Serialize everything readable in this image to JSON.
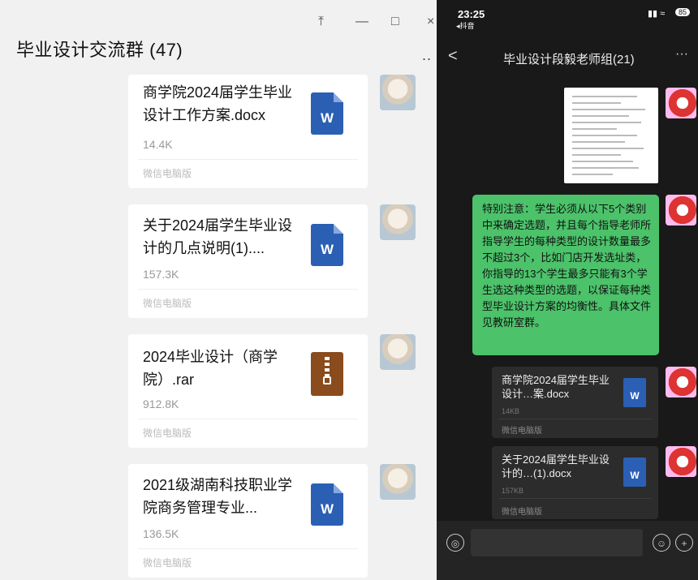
{
  "left": {
    "title": "毕业设计交流群 (47)",
    "window_buttons": {
      "pin": "⤒",
      "min": "—",
      "max": "□",
      "close": "×"
    },
    "more": "..",
    "files": [
      {
        "name": "商学院2024届学生毕业设计工作方案.docx",
        "size": "14.4K",
        "source": "微信电脑版",
        "type": "docx",
        "icon": "W"
      },
      {
        "name": "关于2024届学生毕业设计的几点说明(1)....",
        "size": "157.3K",
        "source": "微信电脑版",
        "type": "docx",
        "icon": "W"
      },
      {
        "name": "2024毕业设计（商学院）.rar",
        "size": "912.8K",
        "source": "微信电脑版",
        "type": "rar",
        "icon": ""
      },
      {
        "name": "2021级湖南科技职业学院商务管理专业...",
        "size": "136.5K",
        "source": "微信电脑版",
        "type": "docx",
        "icon": "W"
      }
    ]
  },
  "right": {
    "status": {
      "time": "23:25",
      "sub": "◂抖音",
      "battery": "85"
    },
    "header": {
      "back": "<",
      "title": "毕业设计段毅老师组(21)",
      "more": "···"
    },
    "notice": "特别注意：学生必须从以下5个类别中来确定选题，并且每个指导老师所指导学生的每种类型的设计数量最多不超过3个，比如门店开发选址类，你指导的13个学生最多只能有3个学生选这种类型的选题，以保证每种类型毕业设计方案的均衡性。具体文件见教研室群。",
    "files": [
      {
        "name": "商学院2024届学生毕业设计…案.docx",
        "size": "14KB",
        "source": "微信电脑版",
        "icon": "W"
      },
      {
        "name": "关于2024届学生毕业设计的…(1).docx",
        "size": "157KB",
        "source": "微信电脑版",
        "icon": "W"
      }
    ],
    "input": {
      "voice": "◎",
      "emoji": "☺",
      "plus": "+"
    }
  }
}
